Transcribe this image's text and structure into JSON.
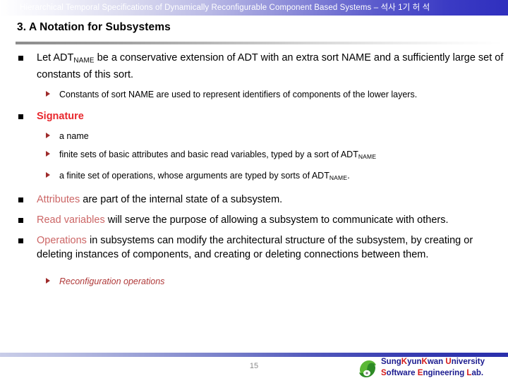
{
  "header": {
    "title": "Hierarchical Temporal Specifications of Dynamically Reconfigurable Component Based Systems – 석사 1기 허 석"
  },
  "slide": {
    "title": "3. A Notation for Subsystems"
  },
  "content": {
    "b1_part1": "Let ADT",
    "b1_sub1": "NAME",
    "b1_part2": " be a conservative extension of ADT with an extra sort NAME and a sufficiently large set of constants of this sort.",
    "b1_child1": "Constants of sort NAME are used to represent identifiers of components of the lower layers.",
    "b2_label": "Signature",
    "b2_child1": "a name",
    "b2_child2_part1": "finite sets of basic attributes and basic read variables, typed by a sort of ADT",
    "b2_child2_sub": "NAME",
    "b2_child3_part1": "a finite set of operations, whose arguments are typed by sorts of ADT",
    "b2_child3_sub": "NAME",
    "b2_child3_part2": ".",
    "b3_accent": "Attributes",
    "b3_rest": " are part of the internal state of a subsystem.",
    "b4_accent": "Read variables",
    "b4_rest": " will serve the purpose of allowing a subsystem to communicate with others.",
    "b5_accent": "Operations",
    "b5_rest": " in subsystems can modify the architectural structure of the subsystem, by creating or deleting instances of components, and creating or deleting connections between them.",
    "b5_child1": "Reconfiguration operations"
  },
  "footer": {
    "page_number": "15",
    "university_s": "S",
    "university_ung": "ung",
    "university_k1": "K",
    "university_yun": "yun",
    "university_k2": "K",
    "university_wan": "wan ",
    "university_u": "U",
    "university_niversity": "niversity",
    "lab_s": "S",
    "lab_oftware": "oftware ",
    "lab_e": "E",
    "lab_ngineering": "ngineering ",
    "lab_l": "L",
    "lab_ab": "ab."
  },
  "colors": {
    "accent_blue": "#2f2fbe",
    "accent_red": "#e8262c",
    "soft_red": "#cc6666",
    "logo_green": "#4aa832",
    "brand_navy": "#1b1b8f"
  }
}
